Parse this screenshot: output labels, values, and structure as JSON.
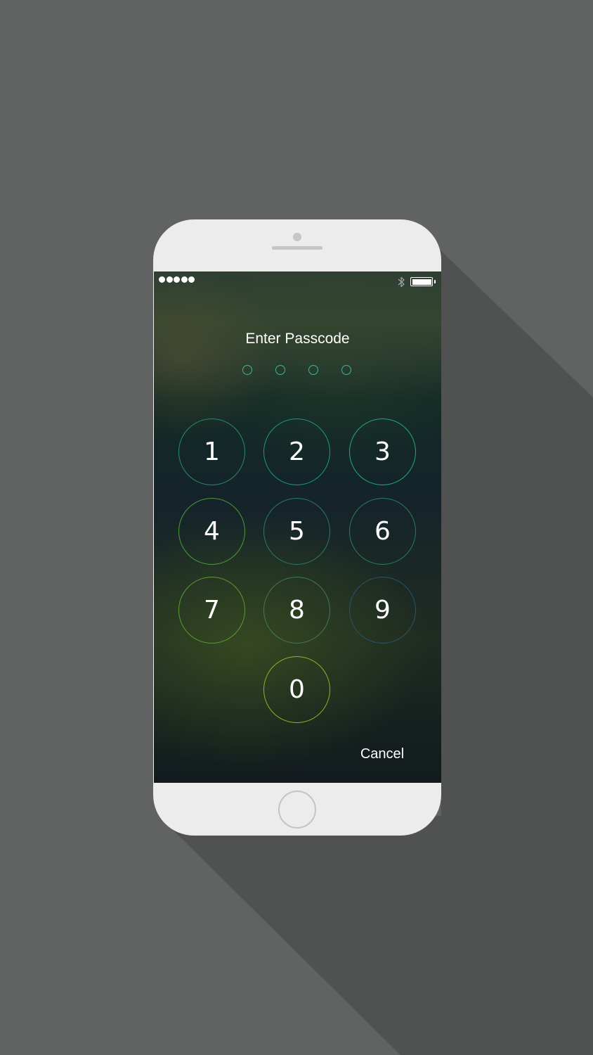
{
  "status_bar": {
    "signal_dots": 5,
    "bluetooth_icon": "bluetooth-icon",
    "battery_icon": "battery-icon",
    "battery_level": 1.0
  },
  "lock_screen": {
    "title": "Enter Passcode",
    "passcode_length": 4,
    "entered_digits": 0
  },
  "keypad": {
    "keys": [
      {
        "label": "1",
        "ring_color": "#2d8a6a"
      },
      {
        "label": "2",
        "ring_color": "#1f9a7a"
      },
      {
        "label": "3",
        "ring_color": "#26a87a"
      },
      {
        "label": "4",
        "ring_color": "#4e9a3c"
      },
      {
        "label": "5",
        "ring_color": "#2c7a63"
      },
      {
        "label": "6",
        "ring_color": "#2c7a60"
      },
      {
        "label": "7",
        "ring_color": "#5a9a38"
      },
      {
        "label": "8",
        "ring_color": "#3f7a52"
      },
      {
        "label": "9",
        "ring_color": "#27556a"
      },
      {
        "label": "0",
        "ring_color": "#8ab52e"
      }
    ]
  },
  "cancel_label": "Cancel",
  "colors": {
    "background": "#616362",
    "shadow": "#505151",
    "phone_body": "#ececec",
    "passcode_dot": "#3fb4a0"
  }
}
